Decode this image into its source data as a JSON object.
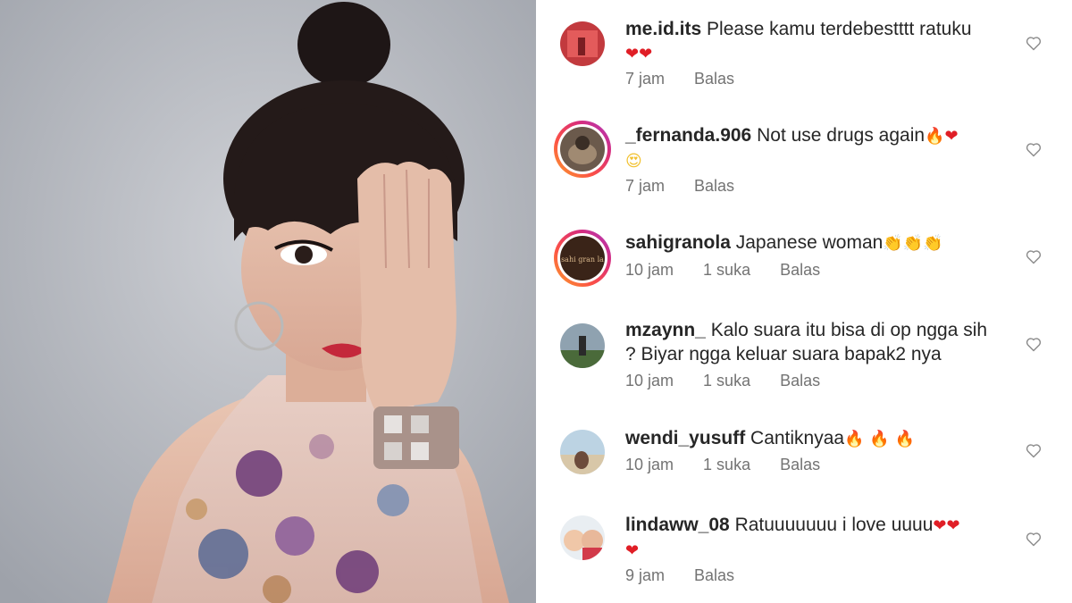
{
  "comments": [
    {
      "username": "me.id.its",
      "text": "Please kamu terdebestttt ratuku",
      "emojis": [
        "❤",
        "❤"
      ],
      "time": "7 jam",
      "likes": "",
      "reply": "Balas"
    },
    {
      "username": "_fernanda.906",
      "text": "Not use drugs again",
      "emojis": [
        "🔥",
        "❤",
        "😍"
      ],
      "time": "7 jam",
      "likes": "",
      "reply": "Balas"
    },
    {
      "username": "sahigranola",
      "text": "Japanese woman",
      "emojis": [
        "👏",
        "👏",
        "👏"
      ],
      "time": "10 jam",
      "likes": "1 suka",
      "reply": "Balas",
      "avatar_text": "sahi gran la"
    },
    {
      "username": "mzaynn_",
      "text": "Kalo suara itu bisa di op ngga sih ? Biyar ngga keluar suara bapak2 nya",
      "emojis": [],
      "time": "10 jam",
      "likes": "1 suka",
      "reply": "Balas"
    },
    {
      "username": "wendi_yusuff",
      "text": "Cantiknyaa",
      "emojis": [
        "🔥",
        "🔥",
        "🔥"
      ],
      "time": "10 jam",
      "likes": "1 suka",
      "reply": "Balas"
    },
    {
      "username": "lindaww_08",
      "text": "Ratuuuuuuu i love uuuu",
      "emojis": [
        "❤",
        "❤",
        "❤"
      ],
      "time": "9 jam",
      "likes": "",
      "reply": "Balas"
    }
  ],
  "icons": {
    "like": "heart-outline-icon"
  },
  "colors": {
    "username": "#262626",
    "meta": "#737373",
    "story_ring": "#d92d7a"
  }
}
